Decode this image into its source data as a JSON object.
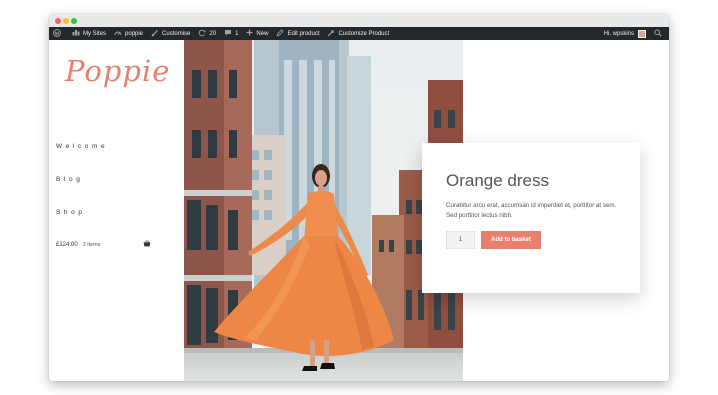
{
  "admin_bar": {
    "my_sites": "My Sites",
    "site_name": "poppie",
    "customise": "Customise",
    "updates_count": "20",
    "comments_count": "1",
    "new_label": "New",
    "edit_product": "Edit product",
    "customize_product": "Customize Product",
    "greeting": "Hi, wpskins"
  },
  "site": {
    "logo": "Poppie",
    "nav": [
      "Welcome",
      "Blog",
      "Shop"
    ],
    "cart": {
      "amount": "£124.00",
      "items": "2 items"
    }
  },
  "product": {
    "title": "Orange dress",
    "description": "Curabitur arcu erat, accumsan id imperdiet et, porttitor at sem. Sed porttitor lectus nibh.",
    "quantity": "1",
    "add_to_basket": "Add to basket"
  },
  "colors": {
    "accent": "#e9806e",
    "admin_bar": "#23282d"
  }
}
